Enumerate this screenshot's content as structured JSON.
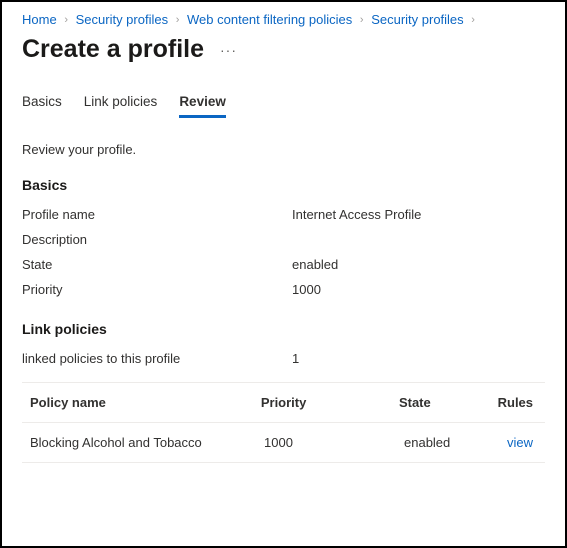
{
  "breadcrumb": {
    "items": [
      "Home",
      "Security profiles",
      "Web content filtering policies",
      "Security profiles"
    ],
    "sep": "›"
  },
  "header": {
    "title": "Create a profile",
    "more_icon": "···"
  },
  "tabs": {
    "items": [
      {
        "label": "Basics"
      },
      {
        "label": "Link policies"
      },
      {
        "label": "Review"
      }
    ],
    "active_index": 2
  },
  "review": {
    "help": "Review your profile."
  },
  "basics": {
    "heading": "Basics",
    "rows": [
      {
        "key": "Profile name",
        "value": "Internet Access Profile"
      },
      {
        "key": "Description",
        "value": ""
      },
      {
        "key": "State",
        "value": "enabled"
      },
      {
        "key": "Priority",
        "value": "1000"
      }
    ]
  },
  "link_policies": {
    "heading": "Link policies",
    "linked_label": "linked policies to this profile",
    "linked_count": "1",
    "table": {
      "columns": {
        "policy": "Policy name",
        "priority": "Priority",
        "state": "State",
        "rules": "Rules"
      },
      "rows": [
        {
          "policy": "Blocking Alcohol and Tobacco",
          "priority": "1000",
          "state": "enabled",
          "rules": "view"
        }
      ]
    }
  }
}
